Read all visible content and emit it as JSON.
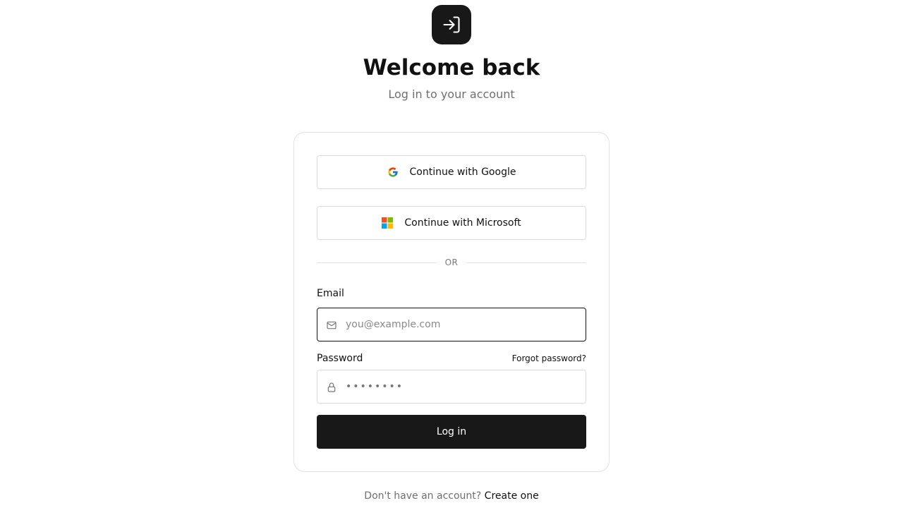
{
  "header": {
    "logo_icon": "log-in-icon",
    "title": "Welcome back",
    "subtitle": "Log in to your account"
  },
  "sso": {
    "google_label": "Continue with Google",
    "google_icon": "google-logo-icon",
    "microsoft_label": "Continue with Microsoft",
    "microsoft_icon": "microsoft-logo-icon"
  },
  "divider": {
    "text": "OR"
  },
  "form": {
    "email_label": "Email",
    "email_placeholder": "you@example.com",
    "email_value": "",
    "email_icon": "mail-icon",
    "password_label": "Password",
    "password_masked": "••••••••",
    "password_icon": "lock-icon",
    "forgot_label": "Forgot password?",
    "submit_label": "Log in"
  },
  "footer": {
    "prompt": "Don't have an account?",
    "link_label": "Create one"
  },
  "colors": {
    "primary": "#181818",
    "muted_text": "#6f6f6f",
    "border": "#dcdcdc",
    "focus_border": "#111111"
  }
}
